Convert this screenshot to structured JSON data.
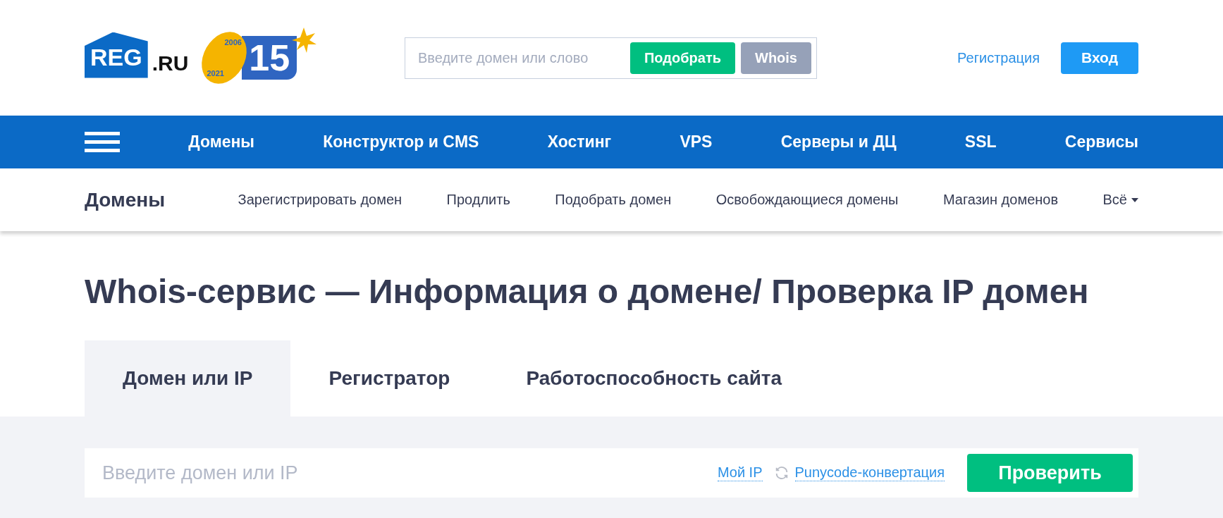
{
  "header": {
    "logo": {
      "mark": "REG",
      "suffix": ".RU"
    },
    "anniversary": {
      "years": [
        "2006",
        "2021"
      ],
      "number": "15"
    },
    "search": {
      "placeholder": "Введите домен или слово",
      "buttons": [
        {
          "label": "Подобрать",
          "kind": "primary"
        },
        {
          "label": "Whois",
          "kind": "secondary"
        }
      ]
    },
    "register_link": "Регистрация",
    "login_button": "Вход"
  },
  "main_nav": {
    "items": [
      "Домены",
      "Конструктор и CMS",
      "Хостинг",
      "VPS",
      "Серверы и ДЦ",
      "SSL",
      "Сервисы"
    ]
  },
  "sub_nav": {
    "title": "Домены",
    "items": [
      "Зарегистрировать домен",
      "Продлить",
      "Подобрать домен",
      "Освобождающиеся домены",
      "Магазин доменов"
    ],
    "more": "Всё"
  },
  "page_title": "Whois-сервис — Информация о домене/ Проверка IP домен",
  "tabs": [
    {
      "label": "Домен или IP",
      "selected": true
    },
    {
      "label": "Регистратор",
      "selected": false
    },
    {
      "label": "Работоспособность сайта",
      "selected": false
    }
  ],
  "form": {
    "placeholder": "Введите домен или IP",
    "my_ip": "Мой IP",
    "punycode": "Punycode-конвертация",
    "submit": "Проверить"
  }
}
